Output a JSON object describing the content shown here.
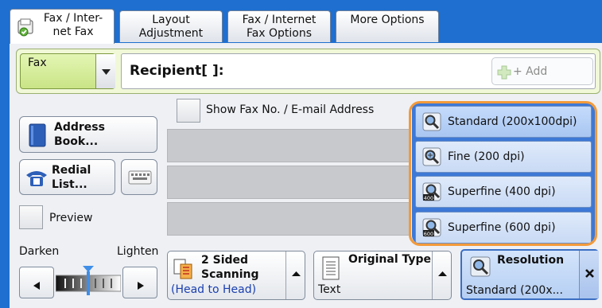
{
  "tabs": [
    {
      "label": "Fax / Inter-\nnet Fax",
      "active": true
    },
    {
      "label": "Layout\nAdjustment",
      "active": false
    },
    {
      "label": "Fax / Internet\nFax Options",
      "active": false
    },
    {
      "label": "More Options",
      "active": false
    }
  ],
  "address_type": {
    "value": "Fax"
  },
  "recipient": {
    "label": "Recipient[   ]:",
    "add_label": "+ Add"
  },
  "show_fax_no": {
    "label": "Show Fax No. / E-mail Address",
    "checked": false
  },
  "address_book": {
    "label": "Address\nBook..."
  },
  "redial_list": {
    "label": "Redial\nList..."
  },
  "preview": {
    "label": "Preview",
    "checked": false
  },
  "density": {
    "darken": "Darken",
    "lighten": "Lighten",
    "level": 0.5
  },
  "two_sided": {
    "label": "2 Sided\nScanning",
    "value": "(Head to Head)"
  },
  "original_type": {
    "label": "Original Type",
    "value": "Text"
  },
  "resolution": {
    "label": "Resolution",
    "value": "Standard (200x..."
  },
  "resolution_options": [
    {
      "label": "Standard (200x100dpi)",
      "selected": true,
      "icon": "standard-resolution-icon"
    },
    {
      "label": "Fine (200 dpi)",
      "selected": false,
      "icon": "fine-resolution-icon"
    },
    {
      "label": "Superfine (400 dpi)",
      "selected": false,
      "icon": "superfine-400-icon",
      "badge": "400"
    },
    {
      "label": "Superfine (600 dpi)",
      "selected": false,
      "icon": "superfine-600-icon",
      "badge": "600"
    }
  ],
  "colors": {
    "accent": "#1e6fcf",
    "highlight": "#f39a3a",
    "link_blue": "#1a3fb0"
  }
}
